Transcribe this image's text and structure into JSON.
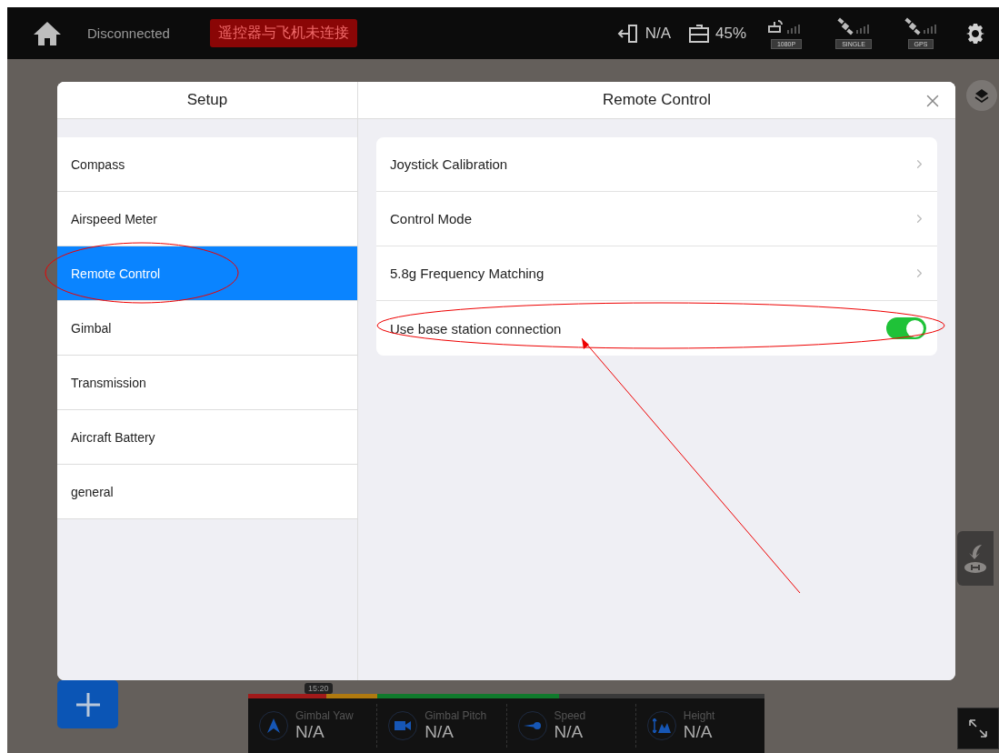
{
  "top_bar": {
    "connection": "Disconnected",
    "alert": "遥控器与飞机未连接",
    "link_status": "N/A",
    "battery": "45%",
    "indicators": [
      {
        "kind": "video",
        "label": "1080P"
      },
      {
        "kind": "satellite",
        "label": "SINGLE"
      },
      {
        "kind": "satellite",
        "label": "GPS"
      }
    ]
  },
  "dialog": {
    "sidebar_title": "Setup",
    "title": "Remote Control",
    "menu": [
      {
        "label": "Compass",
        "selected": false
      },
      {
        "label": "Airspeed Meter",
        "selected": false
      },
      {
        "label": "Remote Control",
        "selected": true
      },
      {
        "label": "Gimbal",
        "selected": false
      },
      {
        "label": "Transmission",
        "selected": false
      },
      {
        "label": "Aircraft Battery",
        "selected": false
      },
      {
        "label": "general",
        "selected": false
      }
    ],
    "settings": [
      {
        "kind": "link",
        "label": "Joystick Calibration"
      },
      {
        "kind": "link",
        "label": "Control Mode"
      },
      {
        "kind": "link",
        "label": "5.8g Frequency Matching"
      },
      {
        "kind": "toggle",
        "label": "Use base station connection",
        "on": true
      }
    ]
  },
  "telemetry": {
    "time": "15:20",
    "items": [
      {
        "kind": "yaw",
        "label": "Gimbal Yaw",
        "value": "N/A"
      },
      {
        "kind": "camera",
        "label": "Gimbal Pitch",
        "value": "N/A"
      },
      {
        "kind": "speed",
        "label": "Speed",
        "value": "N/A"
      },
      {
        "kind": "height",
        "label": "Height",
        "value": "N/A"
      }
    ]
  }
}
